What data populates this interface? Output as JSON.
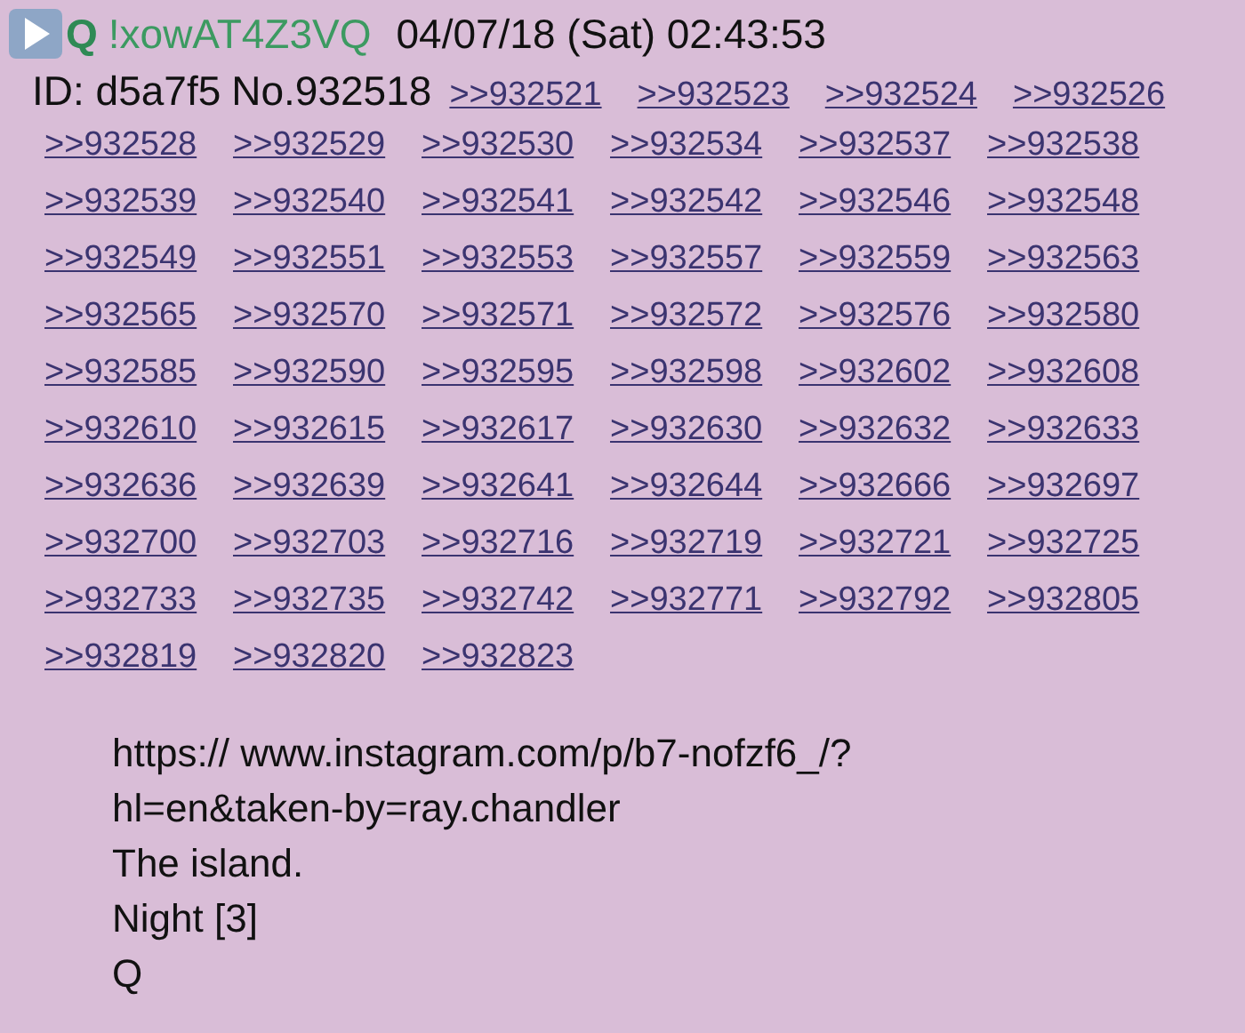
{
  "post": {
    "name": "Q",
    "tripcode": "!xowAT4Z3VQ",
    "datetime": "04/07/18 (Sat) 02:43:53",
    "id": "ID: d5a7f5",
    "number": "No.932518",
    "replies": [
      ">>932521",
      ">>932523",
      ">>932524",
      ">>932526",
      ">>932528",
      ">>932529",
      ">>932530",
      ">>932534",
      ">>932537",
      ">>932538",
      ">>932539",
      ">>932540",
      ">>932541",
      ">>932542",
      ">>932546",
      ">>932548",
      ">>932549",
      ">>932551",
      ">>932553",
      ">>932557",
      ">>932559",
      ">>932563",
      ">>932565",
      ">>932570",
      ">>932571",
      ">>932572",
      ">>932576",
      ">>932580",
      ">>932585",
      ">>932590",
      ">>932595",
      ">>932598",
      ">>932602",
      ">>932608",
      ">>932610",
      ">>932615",
      ">>932617",
      ">>932630",
      ">>932632",
      ">>932633",
      ">>932636",
      ">>932639",
      ">>932641",
      ">>932644",
      ">>932666",
      ">>932697",
      ">>932700",
      ">>932703",
      ">>932716",
      ">>932719",
      ">>932721",
      ">>932725",
      ">>932733",
      ">>932735",
      ">>932742",
      ">>932771",
      ">>932792",
      ">>932805",
      ">>932819",
      ">>932820",
      ">>932823"
    ],
    "body": [
      "https:// www.instagram.com/p/b7-nofzf6_/?",
      "hl=en&taken-by=ray.chandler",
      "The island.",
      "Night [3]",
      "Q"
    ]
  }
}
